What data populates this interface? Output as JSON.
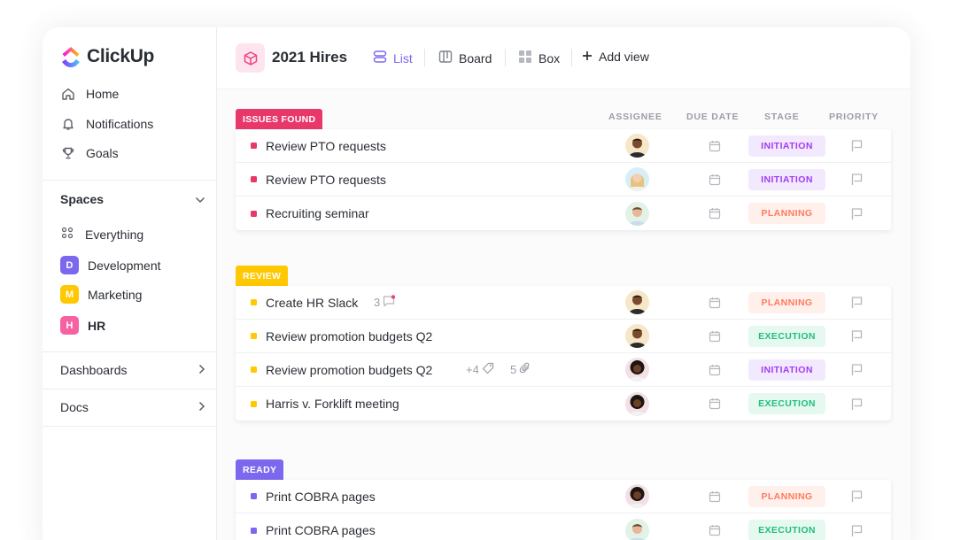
{
  "brand": {
    "name": "ClickUp"
  },
  "nav": [
    {
      "label": "Home",
      "icon": "home-icon"
    },
    {
      "label": "Notifications",
      "icon": "bell-icon"
    },
    {
      "label": "Goals",
      "icon": "trophy-icon"
    }
  ],
  "spaces": {
    "header": "Spaces",
    "everything": "Everything",
    "items": [
      {
        "letter": "D",
        "label": "Development",
        "color": "#7b68ee"
      },
      {
        "letter": "M",
        "label": "Marketing",
        "color": "#ffc800"
      },
      {
        "letter": "H",
        "label": "HR",
        "color": "#f562a3"
      }
    ]
  },
  "sections": [
    {
      "label": "Dashboards"
    },
    {
      "label": "Docs"
    }
  ],
  "project": {
    "title": "2021 Hires"
  },
  "views": [
    {
      "label": "List",
      "icon": "list-icon"
    },
    {
      "label": "Board",
      "icon": "board-icon"
    },
    {
      "label": "Box",
      "icon": "box-icon"
    },
    {
      "label": "Add view",
      "icon": "plus-icon"
    }
  ],
  "columns": {
    "assignee": "ASSIGNEE",
    "due_date": "DUE DATE",
    "stage": "STAGE",
    "priority": "PRIORITY"
  },
  "stage_colors": {
    "INITIATION": {
      "bg": "#f3e9ff",
      "fg": "#a23cf0"
    },
    "PLANNING": {
      "bg": "#fff0ec",
      "fg": "#ff7b5c"
    },
    "EXECUTION": {
      "bg": "#e6f9f0",
      "fg": "#1fbf7a"
    }
  },
  "groups": [
    {
      "status": "ISSUES FOUND",
      "color": "#e8386a",
      "tasks": [
        {
          "name": "Review PTO requests",
          "stage": "INITIATION",
          "avatar": "dark"
        },
        {
          "name": "Review PTO requests",
          "stage": "INITIATION",
          "avatar": "blonde"
        },
        {
          "name": "Recruiting seminar",
          "stage": "PLANNING",
          "avatar": "light"
        }
      ]
    },
    {
      "status": "REVIEW",
      "color": "#ffc800",
      "tasks": [
        {
          "name": "Create HR Slack",
          "stage": "PLANNING",
          "avatar": "dark",
          "comments": "3"
        },
        {
          "name": "Review promotion budgets Q2",
          "stage": "EXECUTION",
          "avatar": "dark"
        },
        {
          "name": "Review promotion budgets Q2",
          "stage": "INITIATION",
          "avatar": "curly",
          "tags": "+4",
          "attachments": "5"
        },
        {
          "name": "Harris v. Forklift meeting",
          "stage": "EXECUTION",
          "avatar": "curly"
        }
      ]
    },
    {
      "status": "READY",
      "color": "#7b68ee",
      "tasks": [
        {
          "name": "Print COBRA pages",
          "stage": "PLANNING",
          "avatar": "curly"
        },
        {
          "name": "Print COBRA pages",
          "stage": "EXECUTION",
          "avatar": "light"
        }
      ]
    }
  ]
}
